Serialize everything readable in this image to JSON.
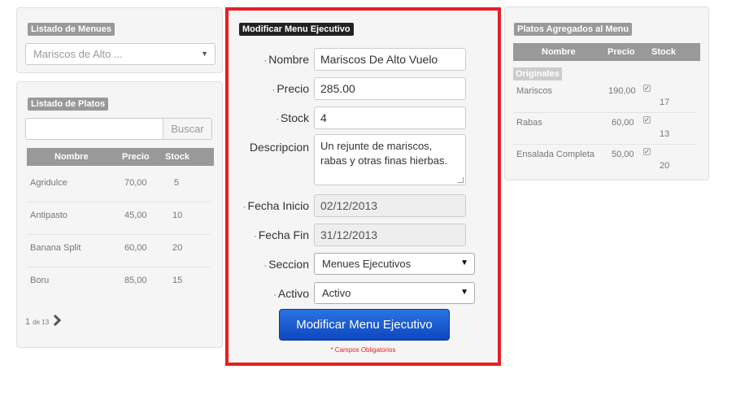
{
  "menues": {
    "title": "Listado de Menues",
    "selected": "Mariscos de Alto ..."
  },
  "platos": {
    "title": "Listado de Platos",
    "search_placeholder": "",
    "search_button": "Buscar",
    "columns": [
      "Nombre",
      "Precio",
      "Stock"
    ],
    "rows": [
      {
        "nombre": "Agridulce",
        "precio": "70,00",
        "stock": "5"
      },
      {
        "nombre": "Antipasto",
        "precio": "45,00",
        "stock": "10"
      },
      {
        "nombre": "Banana Split",
        "precio": "60,00",
        "stock": "20"
      },
      {
        "nombre": "Boru",
        "precio": "85,00",
        "stock": "15"
      }
    ],
    "pager": {
      "current": "1",
      "of_label": "de 13"
    }
  },
  "form": {
    "title": "Modificar Menu Ejecutivo",
    "required_mark": "·",
    "fields": {
      "nombre": {
        "label": "Nombre",
        "value": "Mariscos De Alto Vuelo"
      },
      "precio": {
        "label": "Precio",
        "value": "285.00"
      },
      "stock": {
        "label": "Stock",
        "value": "4"
      },
      "descripcion": {
        "label": "Descripcion",
        "line1": "Un rejunte de mariscos,",
        "line2": "rabas y otras finas hierbas."
      },
      "fecha_inicio": {
        "label": "Fecha Inicio",
        "value": "02/12/2013"
      },
      "fecha_fin": {
        "label": "Fecha Fin",
        "value": "31/12/2013"
      },
      "seccion": {
        "label": "Seccion",
        "value": "Menues Ejecutivos"
      },
      "activo": {
        "label": "Activo",
        "value": "Activo"
      }
    },
    "submit": "Modificar Menu Ejecutivo",
    "required_note": "* Campos Obligatorios"
  },
  "agregados": {
    "title": "Platos Agregados al Menu",
    "columns": [
      "Nombre",
      "Precio",
      "Stock"
    ],
    "group": "Originales",
    "rows": [
      {
        "nombre": "Mariscos",
        "precio": "190,00",
        "stock": "17",
        "checked": true
      },
      {
        "nombre": "Rabas",
        "precio": "60,00",
        "stock": "13",
        "checked": true
      },
      {
        "nombre": "Ensalada Completa",
        "precio": "50,00",
        "stock": "20",
        "checked": true
      }
    ]
  },
  "colors": {
    "highlight_border": "#e32028",
    "submit_button": "#1a5ad0",
    "tag_gray": "#999999",
    "tag_dark": "#222222"
  },
  "icons": [
    "chevron-down-icon",
    "chevron-right-icon",
    "checkbox-icon",
    "resize-grip-icon"
  ]
}
